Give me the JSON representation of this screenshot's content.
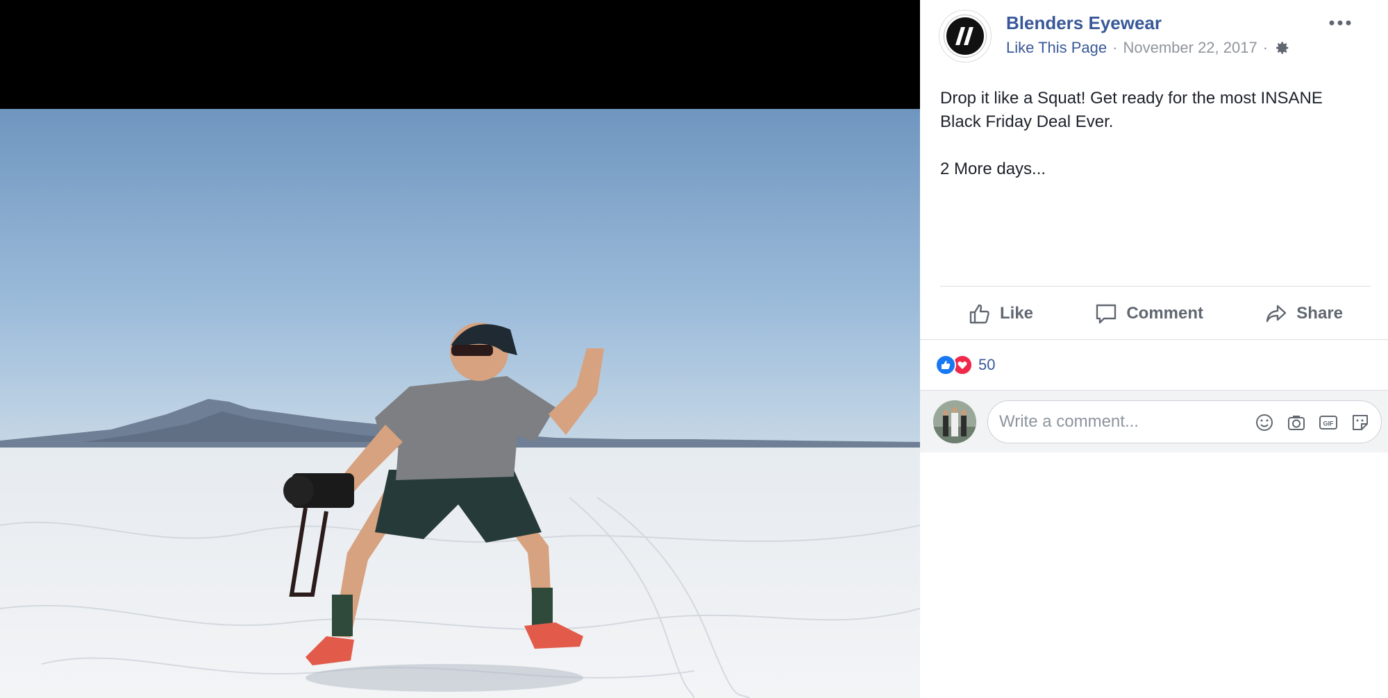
{
  "post": {
    "page_name": "Blenders Eyewear",
    "like_page": "Like This Page",
    "separator": "·",
    "date": "November 22, 2017",
    "text_line1": "Drop it like a Squat! Get ready for the most INSANE Black Friday Deal Ever.",
    "text_line2": "2 More days..."
  },
  "actions": {
    "like": "Like",
    "comment": "Comment",
    "share": "Share"
  },
  "reactions": {
    "count": "50"
  },
  "comment": {
    "placeholder": "Write a comment..."
  },
  "colors": {
    "link_blue": "#385898",
    "meta_gray": "#90949c",
    "like_reaction": "#1877f2",
    "love_reaction": "#f0284a"
  },
  "icons": [
    "gear-icon",
    "more-options-icon",
    "thumbs-up-icon",
    "comment-icon",
    "share-icon",
    "emoji-icon",
    "camera-icon",
    "gif-icon",
    "sticker-icon"
  ]
}
